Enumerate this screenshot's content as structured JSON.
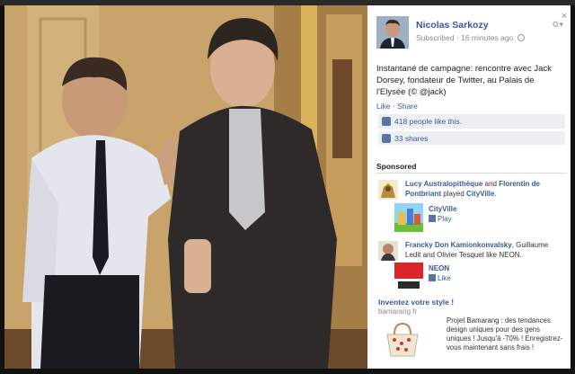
{
  "post": {
    "author": "Nicolas Sarkozy",
    "subscribed": "Subscribed",
    "time": "16 minutes ago",
    "caption": "Instantané de campagne: rencontre avec Jack Dorsey, fondateur de Twitter, au Palais de l'Elysée (© @jack)",
    "like": "Like",
    "share": "Share",
    "likes_text": "418 people like this.",
    "shares_text": "33 shares"
  },
  "sponsored": {
    "heading": "Sponsored",
    "ads": [
      {
        "user1": "Lucy Australopithèque",
        "and": "and",
        "user2": "Florentin de Pontbriant",
        "played": "played",
        "app": "CityVille",
        "card_name": "CityVille",
        "card_action": "Play"
      },
      {
        "user1": "Francky Don Kamionkonvalsky",
        "rest": ", Guillaume Ledit and Olivier Tesquet like NEON.",
        "card_name": "NEON",
        "card_action": "Like"
      }
    ],
    "promo": {
      "title": "Inventez votre style !",
      "url": "bamarang.fr",
      "text": "Projet Bamarang : des tendances design uniques pour des gens uniques ! Jusqu'à -70% ! Enregistrez-vous maintenant sans frais !"
    }
  },
  "colors": {
    "link": "#3b5998",
    "stat_bg": "#edeff4"
  }
}
